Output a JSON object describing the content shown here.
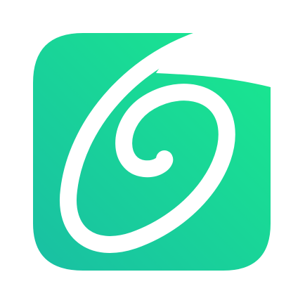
{
  "logo": {
    "icon": "green-spiral-app-icon",
    "colors": {
      "gradient_top_right": "#19E98E",
      "gradient_bottom_left": "#19BFA3",
      "swirl": "#FFFFFF",
      "background": "#FFFFFF"
    }
  }
}
